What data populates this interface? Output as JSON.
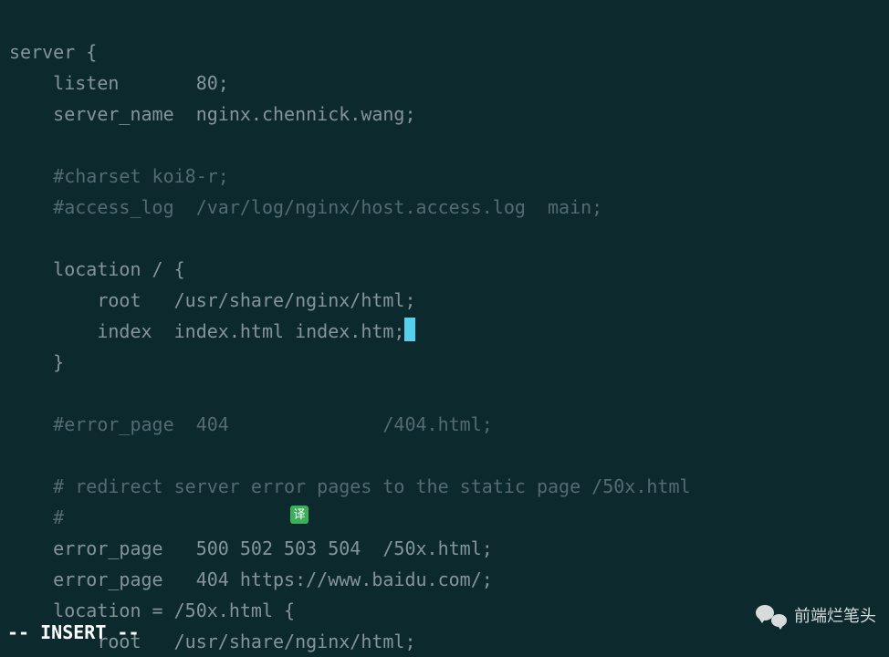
{
  "code": {
    "l1": "server {",
    "l2": "    listen       80;",
    "l3": "    server_name  nginx.chennick.wang;",
    "l4": "",
    "l5": "    #charset koi8-r;",
    "l6": "    #access_log  /var/log/nginx/host.access.log  main;",
    "l7": "",
    "l8": "    location / {",
    "l9": "        root   /usr/share/nginx/html;",
    "l10": "        index  index.html index.htm;",
    "l11": "    }",
    "l12": "",
    "l13": "    #error_page  404              /404.html;",
    "l14": "",
    "l15": "    # redirect server error pages to the static page /50x.html",
    "l16": "    #",
    "l17": "    error_page   500 502 503 504  /50x.html;",
    "l18": "    error_page   404 https://www.baidu.com/;",
    "l19": "    location = /50x.html {",
    "l20": "        root   /usr/share/nginx/html;"
  },
  "status": "-- INSERT --",
  "badge": "译",
  "watermark": "前端烂笔头"
}
